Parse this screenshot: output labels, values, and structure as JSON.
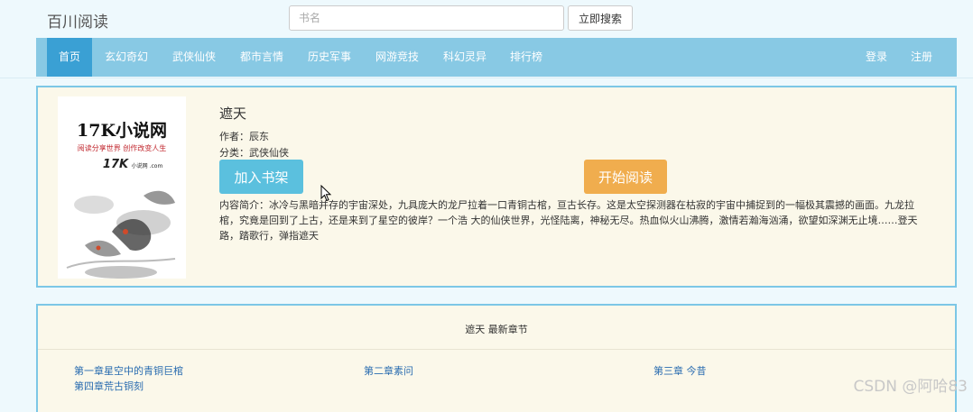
{
  "header": {
    "brand": "百川阅读",
    "search_placeholder": "书名",
    "search_button": "立即搜索"
  },
  "nav": {
    "items": [
      "首页",
      "玄幻奇幻",
      "武侠仙侠",
      "都市言情",
      "历史军事",
      "网游竞技",
      "科幻灵异",
      "排行榜"
    ],
    "active_index": 0,
    "login": "登录",
    "register": "注册"
  },
  "book": {
    "title": "遮天",
    "author": "作者：辰东",
    "category": "分类：武侠仙侠",
    "add_button": "加入书架",
    "read_button": "开始阅读",
    "description": "内容简介：冰冷与黑暗并存的宇宙深处，九具庞大的龙尸拉着一口青铜古棺，亘古长存。这是太空探测器在枯寂的宇宙中捕捉到的一幅极其震撼的画面。九龙拉棺，究竟是回到了上古，还是来到了星空的彼岸？一个浩 大的仙侠世界，光怪陆离，神秘无尽。热血似火山沸腾，激情若瀚海汹涌，欲望如深渊无止境……登天路，踏歌行，弹指遮天",
    "cover": {
      "site_name": "17K小说网",
      "slogan": "阅读分享世界 创作改变人生",
      "logo_text": "17K",
      "logo_sub": "小说网 .com"
    }
  },
  "chapters": {
    "heading": "遮天 最新章节",
    "items": [
      "第一章星空中的青铜巨棺",
      "第二章素问",
      "第三章 今昔",
      "第四章荒古铜刻"
    ]
  },
  "watermark": "CSDN @阿哈83",
  "colors": {
    "nav_bg": "#88c9e4",
    "nav_active": "#3aa0d4",
    "panel_border": "#7cc7e6",
    "panel_bg": "#fbf8ea",
    "btn_info": "#5bc0de",
    "btn_warning": "#f0ad4e",
    "link": "#2a6cb0"
  }
}
